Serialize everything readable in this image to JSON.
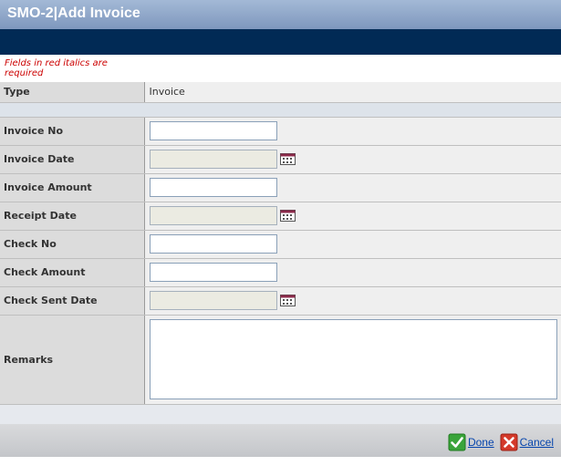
{
  "window": {
    "title": "SMO-2|Add Invoice"
  },
  "note": {
    "text": "Fields in red italics are required"
  },
  "type_row": {
    "label": "Type",
    "value": "Invoice"
  },
  "fields": {
    "invoice_no": {
      "label": "Invoice No",
      "value": ""
    },
    "invoice_date": {
      "label": "Invoice Date",
      "value": ""
    },
    "invoice_amount": {
      "label": "Invoice Amount",
      "value": ""
    },
    "receipt_date": {
      "label": "Receipt Date",
      "value": ""
    },
    "check_no": {
      "label": "Check No",
      "value": ""
    },
    "check_amount": {
      "label": "Check Amount",
      "value": ""
    },
    "check_sent_date": {
      "label": "Check Sent Date",
      "value": ""
    },
    "remarks": {
      "label": "Remarks",
      "value": ""
    }
  },
  "icons": {
    "calendar": "calendar-icon",
    "done": "check-icon",
    "cancel": "close-icon"
  },
  "colors": {
    "title_bar": "#8aa3c6",
    "nav_bar": "#012a55",
    "required_note": "#cc0000",
    "done_icon": "#3aa43a",
    "cancel_icon": "#d43a2a"
  },
  "footer": {
    "done_label": "Done",
    "cancel_label": "Cancel"
  }
}
